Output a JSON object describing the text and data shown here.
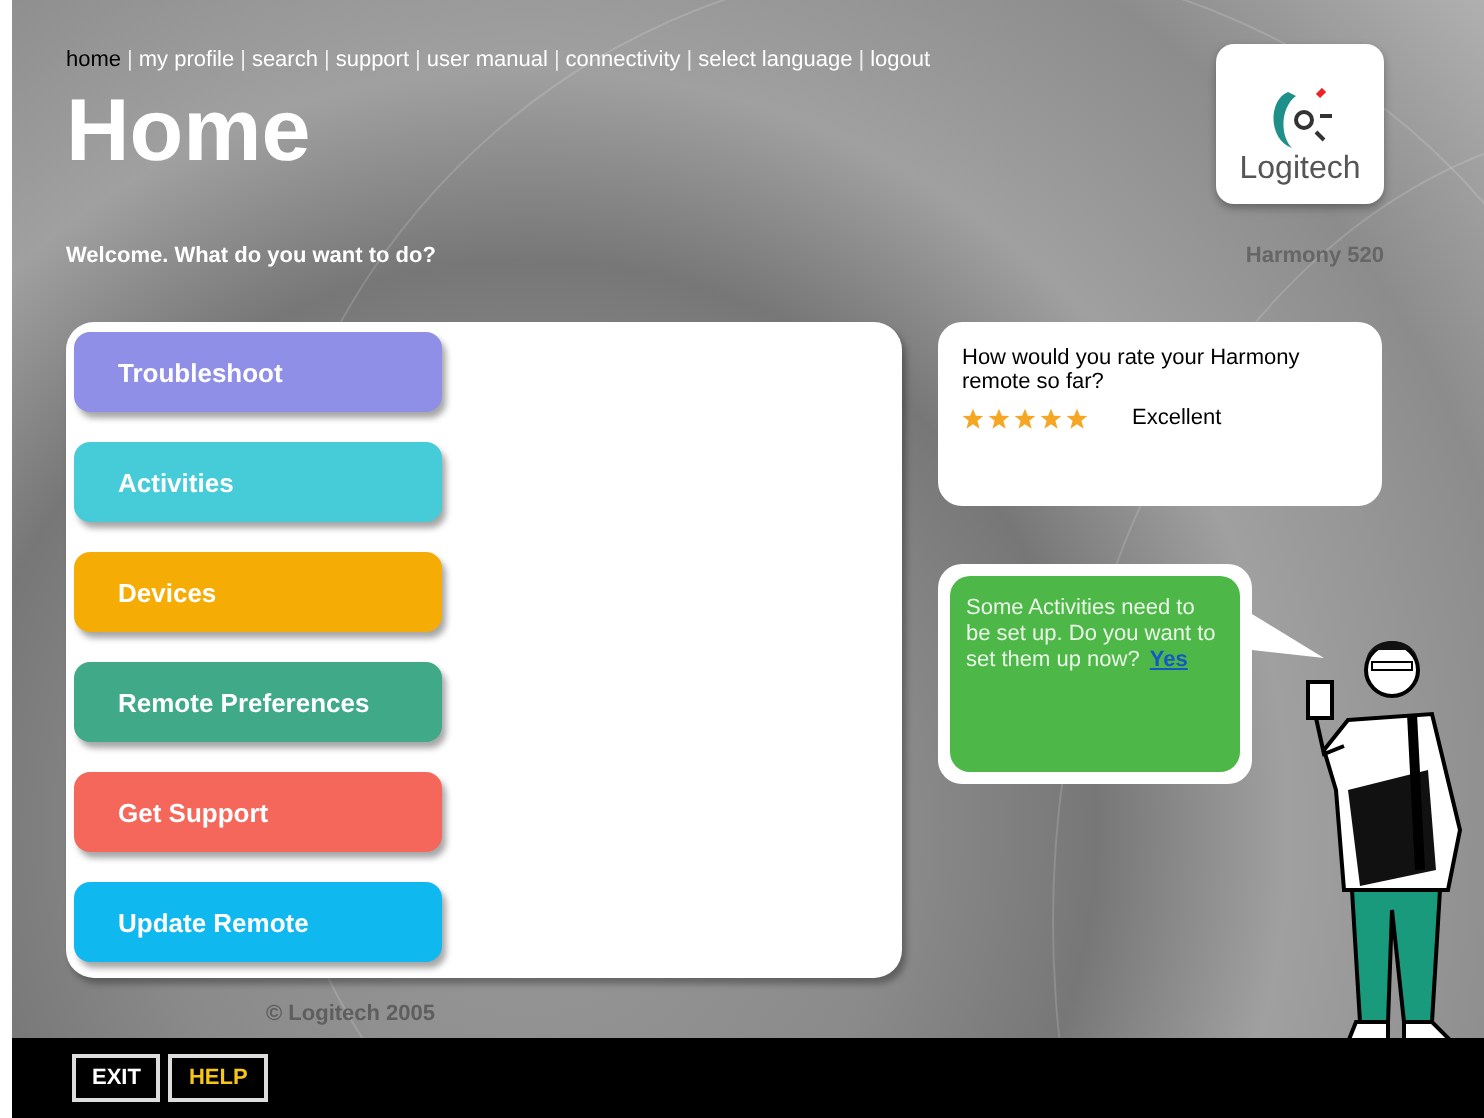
{
  "nav": [
    {
      "label": "home",
      "selected": true
    },
    {
      "label": "my profile",
      "selected": false
    },
    {
      "label": "search",
      "selected": false
    },
    {
      "label": "support",
      "selected": false
    },
    {
      "label": "user manual",
      "selected": false
    },
    {
      "label": "connectivity",
      "selected": false
    },
    {
      "label": "select language",
      "selected": false
    },
    {
      "label": "logout",
      "selected": false
    }
  ],
  "nav_separator": "|",
  "title": "Home",
  "logo": {
    "text": "Logitech"
  },
  "welcome": "Welcome. What do you want to do?",
  "model": "Harmony 520",
  "menu": [
    {
      "label": "Troubleshoot",
      "color": "#8f8fe8"
    },
    {
      "label": "Activities",
      "color": "#46cbd9"
    },
    {
      "label": "Devices",
      "color": "#f5ad06"
    },
    {
      "label": "Remote Preferences",
      "color": "#3fa988"
    },
    {
      "label": "Get Support",
      "color": "#f5675a"
    },
    {
      "label": "Update Remote",
      "color": "#10b8f0"
    }
  ],
  "rating": {
    "question": "How would you rate your Harmony remote so far?",
    "stars": 5,
    "label": "Excellent"
  },
  "prompt": {
    "text": "Some Activities need to be set up. Do you want to set them up now?",
    "link": "Yes"
  },
  "copyright": "© Logitech 2005",
  "footer": {
    "buttons": [
      {
        "label": "EXIT",
        "kind": "exit"
      },
      {
        "label": "HELP",
        "kind": "help"
      }
    ]
  }
}
